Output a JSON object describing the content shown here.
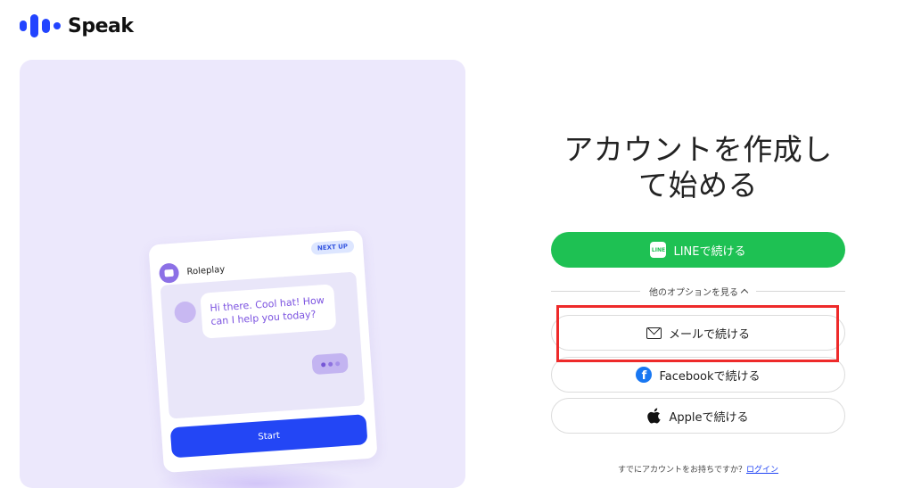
{
  "brand": {
    "name": "Speak",
    "color": "#2244ff"
  },
  "hero": {
    "card": {
      "title": "Roleplay",
      "badge": "NEXT UP",
      "message": "Hi there. Cool hat! How can I help you today?",
      "typing_icon": "typing-dots-icon",
      "start_label": "Start"
    }
  },
  "signup": {
    "heading_line1": "アカウントを作成し",
    "heading_line2": "て始める",
    "line_button": {
      "label": "LINEで続ける",
      "icon": "line-icon",
      "icon_text": "LINE",
      "color": "#1ec153"
    },
    "more_options": {
      "label": "他のオプションを見る",
      "icon": "chevron-up-icon"
    },
    "email_button": {
      "label": "メールで続ける",
      "icon": "mail-icon"
    },
    "facebook_button": {
      "label": "Facebookで続ける",
      "icon": "facebook-icon",
      "icon_text": "f",
      "color": "#1877f2"
    },
    "apple_button": {
      "label": "Appleで続ける",
      "icon": "apple-icon"
    },
    "footer": {
      "text": "すでにアカウントをお持ちですか？",
      "login_label": "ログイン"
    }
  },
  "highlight_color": "#ee2a2a"
}
